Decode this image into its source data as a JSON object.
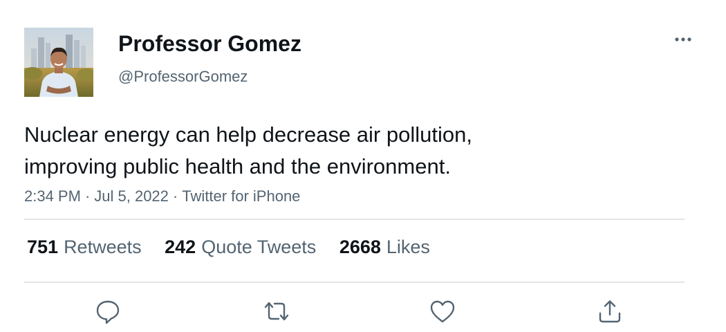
{
  "author": {
    "name": "Professor Gomez",
    "handle": "@ProfessorGomez"
  },
  "tweet": {
    "lines": [
      "Nuclear energy can help decrease air pollution,",
      "improving public health and the environment."
    ],
    "time": "2:34 PM",
    "date": "Jul 5, 2022",
    "source": "Twitter for iPhone",
    "separator": "·"
  },
  "stats": {
    "retweets": {
      "count": "751",
      "label": "Retweets"
    },
    "quotes": {
      "count": "242",
      "label": "Quote Tweets"
    },
    "likes": {
      "count": "2668",
      "label": "Likes"
    }
  },
  "icons": {
    "avatar": "avatar-photo",
    "more": "more-horizontal-icon",
    "reply": "reply-icon",
    "retweet": "retweet-icon",
    "like": "heart-icon",
    "share": "share-icon"
  },
  "colors": {
    "text_primary": "#0f1419",
    "text_secondary": "#536471",
    "icon": "#536471",
    "divider": "#e1e5e8"
  }
}
